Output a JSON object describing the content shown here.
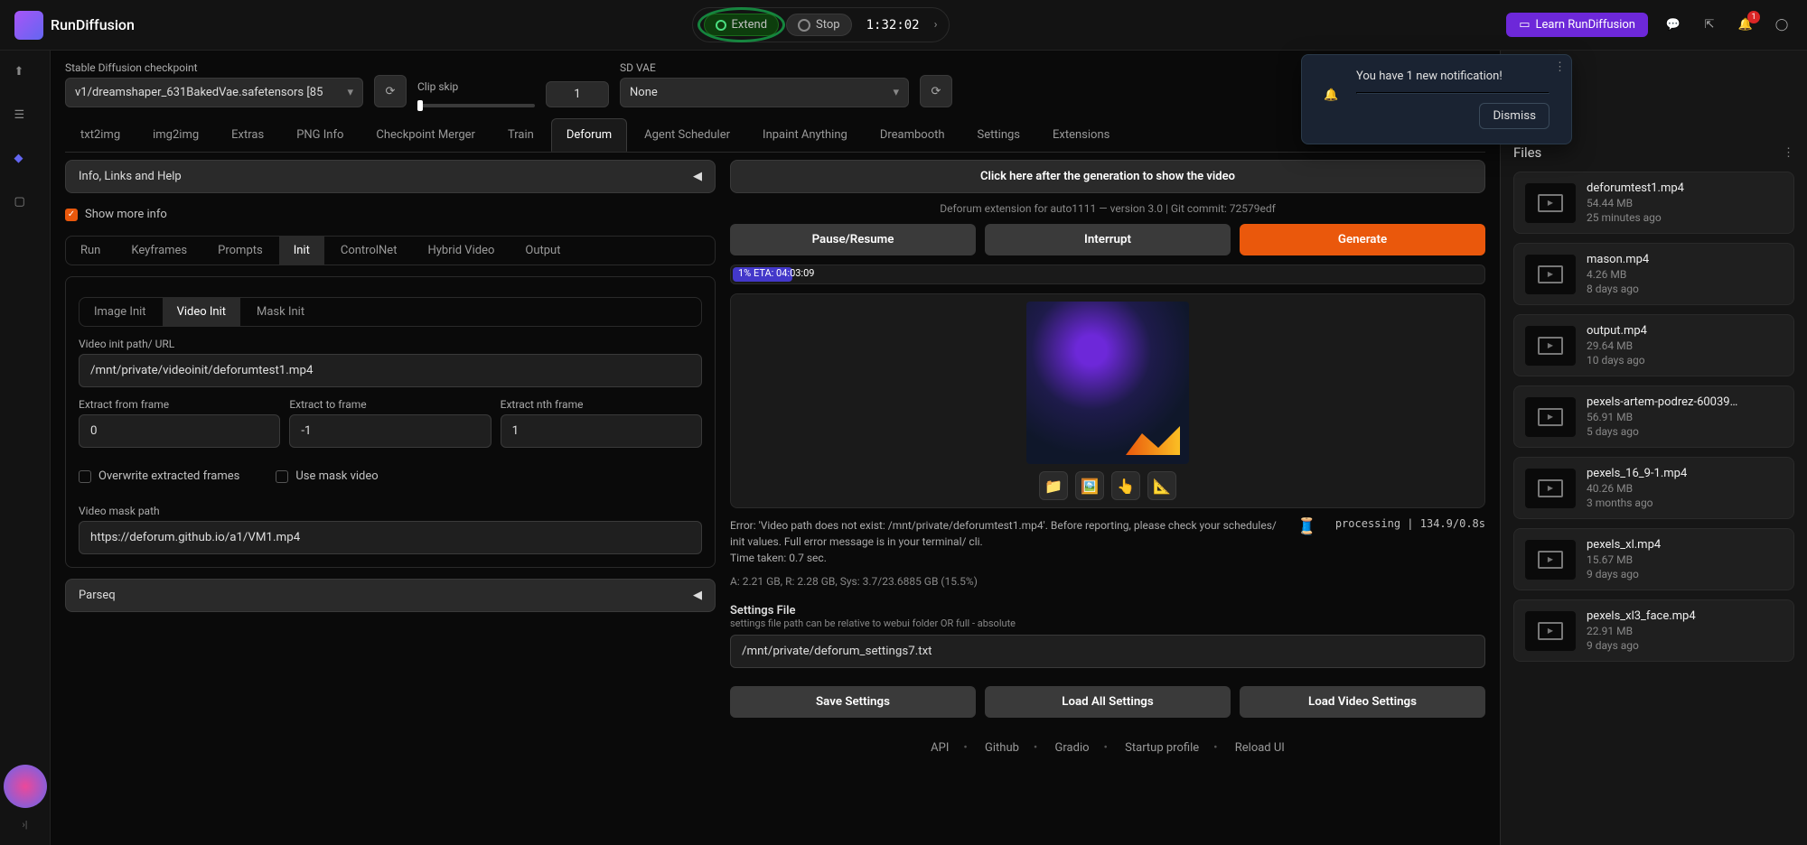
{
  "topbar": {
    "brand": "RunDiffusion",
    "extend": "Extend",
    "stop": "Stop",
    "timer": "1:32:02",
    "learn": "Learn RunDiffusion",
    "badge": "1"
  },
  "config": {
    "checkpoint_label": "Stable Diffusion checkpoint",
    "checkpoint_value": "v1/dreamshaper_631BakedVae.safetensors [85",
    "clip_label": "Clip skip",
    "clip_value": "1",
    "vae_label": "SD VAE",
    "vae_value": "None"
  },
  "tabs": [
    "txt2img",
    "img2img",
    "Extras",
    "PNG Info",
    "Checkpoint Merger",
    "Train",
    "Deforum",
    "Agent Scheduler",
    "Inpaint Anything",
    "Dreambooth",
    "Settings",
    "Extensions"
  ],
  "active_tab": 6,
  "left": {
    "info_panel": "Info, Links and Help",
    "show_more": "Show more info",
    "subtabs": [
      "Run",
      "Keyframes",
      "Prompts",
      "Init",
      "ControlNet",
      "Hybrid Video",
      "Output"
    ],
    "active_subtab": 3,
    "initTabs": [
      "Image Init",
      "Video Init",
      "Mask Init"
    ],
    "active_init": 1,
    "video_init_label": "Video init path/ URL",
    "video_init_value": "/mnt/private/videoinit/deforumtest1.mp4",
    "extract_from_label": "Extract from frame",
    "extract_from_value": "0",
    "extract_to_label": "Extract to frame",
    "extract_to_value": "-1",
    "extract_nth_label": "Extract nth frame",
    "extract_nth_value": "1",
    "overwrite_label": "Overwrite extracted frames",
    "use_mask_label": "Use mask video",
    "mask_path_label": "Video mask path",
    "mask_path_value": "https://deforum.github.io/a1/VM1.mp4",
    "parseq": "Parseq"
  },
  "right": {
    "click_banner": "Click here after the generation to show the video",
    "ext_info": "Deforum extension for auto1111 — version 3.0 | Git commit: 72579edf",
    "pause": "Pause/Resume",
    "interrupt": "Interrupt",
    "generate": "Generate",
    "progress": "1% ETA: 04:03:09",
    "error_l1": "Error: 'Video path does not exist: /mnt/private/deforumtest1.mp4'. Before reporting, please check your schedules/ init values. Full error message is in your terminal/ cli.",
    "time_taken": "Time taken: 0.7 sec.",
    "processing": "processing | 134.9/0.8s",
    "mem": "A: 2.21 GB, R: 2.28 GB, Sys: 3.7/23.6885 GB (15.5%)",
    "settings_file_label": "Settings File",
    "settings_file_help": "settings file path can be relative to webui folder OR full - absolute",
    "settings_file_value": "/mnt/private/deforum_settings7.txt",
    "save_settings": "Save Settings",
    "load_all": "Load All Settings",
    "load_video": "Load Video Settings"
  },
  "footer": {
    "api": "API",
    "github": "Github",
    "gradio": "Gradio",
    "startup": "Startup profile",
    "reload": "Reload UI"
  },
  "notification": {
    "text": "You have 1 new notification!",
    "dismiss": "Dismiss"
  },
  "files": {
    "title": "Files",
    "items": [
      {
        "name": "deforumtest1.mp4",
        "size": "54.44 MB",
        "time": "25 minutes ago"
      },
      {
        "name": "mason.mp4",
        "size": "4.26 MB",
        "time": "8 days ago"
      },
      {
        "name": "output.mp4",
        "size": "29.64 MB",
        "time": "10 days ago"
      },
      {
        "name": "pexels-artem-podrez-60039…",
        "size": "56.91 MB",
        "time": "5 days ago"
      },
      {
        "name": "pexels_16_9-1.mp4",
        "size": "40.26 MB",
        "time": "3 months ago"
      },
      {
        "name": "pexels_xl.mp4",
        "size": "15.67 MB",
        "time": "9 days ago"
      },
      {
        "name": "pexels_xl3_face.mp4",
        "size": "22.91 MB",
        "time": "9 days ago"
      }
    ]
  }
}
